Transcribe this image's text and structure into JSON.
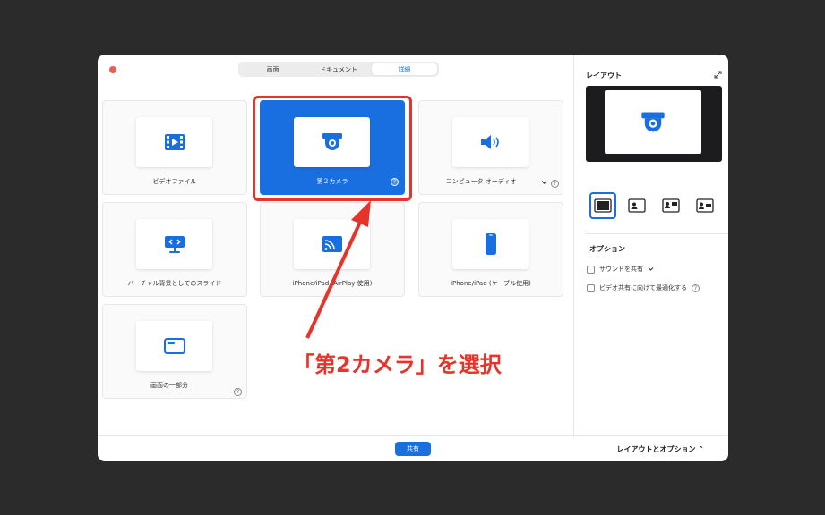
{
  "tabs": [
    {
      "label": "画面"
    },
    {
      "label": "ドキュメント"
    },
    {
      "label": "詳細",
      "active": true
    }
  ],
  "tiles": [
    {
      "label": "ビデオファイル",
      "icon": "video-file-icon"
    },
    {
      "label": "第２カメラ",
      "icon": "camera-icon",
      "selected": true,
      "help": "?"
    },
    {
      "label": "コンピュータ オーディオ",
      "icon": "speaker-icon",
      "help": "?"
    },
    {
      "label": "バーチャル背景としてのスライド",
      "icon": "slides-icon"
    },
    {
      "label": "iPhone/iPad (AirPlay 使用)",
      "icon": "airplay-icon"
    },
    {
      "label": "iPhone/iPad (ケーブル使用)",
      "icon": "phone-icon"
    },
    {
      "label": "画面の一部分",
      "icon": "window-icon",
      "help": "?"
    }
  ],
  "right_panel": {
    "layout_title": "レイアウト",
    "options_title": "オプション",
    "options": [
      {
        "label": "サウンドを共有",
        "checked": false
      },
      {
        "label": "ビデオ共有に向けて最適化する",
        "checked": false
      }
    ],
    "help": "?"
  },
  "bottom": {
    "share_label": "共有",
    "layout_toggle": "レイアウトとオプション ⌃"
  },
  "annotation": "「第2カメラ」を選択",
  "colors": {
    "accent": "#1a6fe0",
    "annotation": "#e8332a"
  }
}
